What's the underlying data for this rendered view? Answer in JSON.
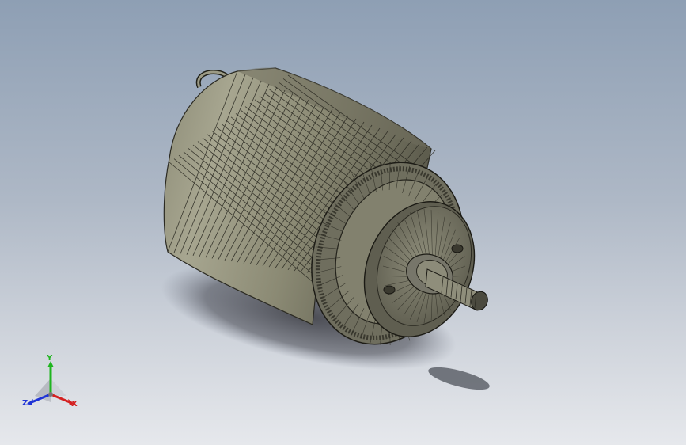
{
  "viewport": {
    "model": "motor-mesh"
  },
  "triad": {
    "x_label": "X",
    "y_label": "Y",
    "z_label": "Z",
    "colors": {
      "x": "#d42020",
      "y": "#1fb51f",
      "z": "#1f33d6"
    }
  }
}
